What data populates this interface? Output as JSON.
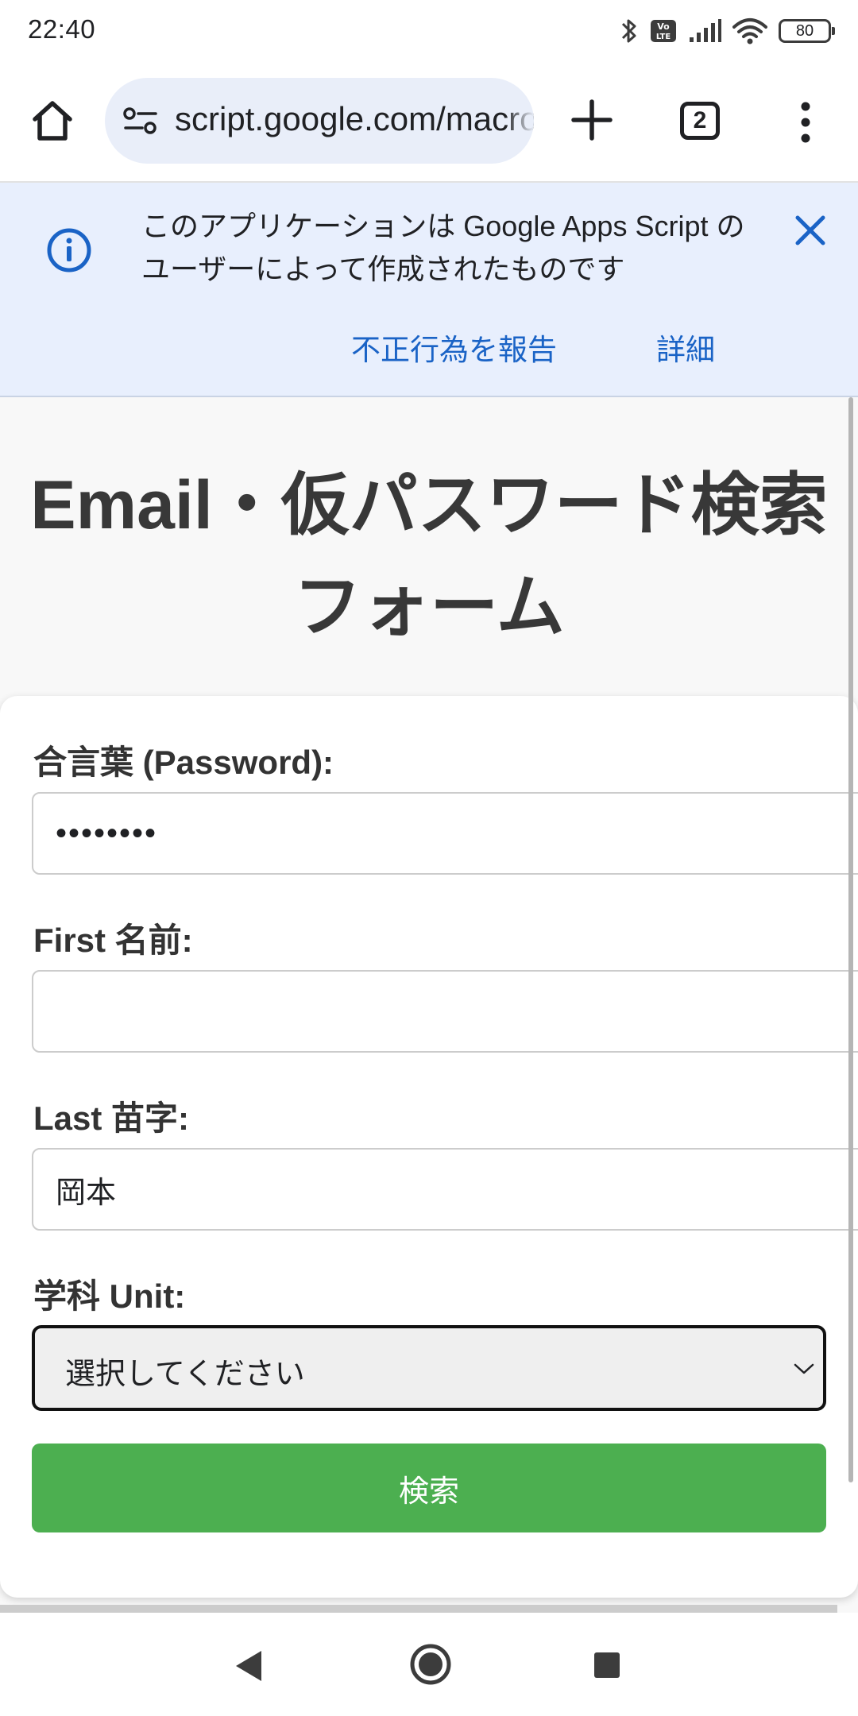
{
  "status_bar": {
    "time": "22:40",
    "battery_level": "80",
    "network_badge": "Vo LTE"
  },
  "browser": {
    "url": "script.google.com/macros/s",
    "tab_count": "2",
    "icons": [
      "home-icon",
      "site-settings-icon",
      "new-tab-icon",
      "tabs-icon",
      "menu-icon"
    ]
  },
  "banner": {
    "message": "このアプリケーションは Google Apps Script のユーザーによって作成されたものです",
    "report_link": "不正行為を報告",
    "details_link": "詳細",
    "icons": [
      "info-icon",
      "close-icon"
    ],
    "background_color": "#e8effd",
    "link_color": "#1a63c6"
  },
  "page": {
    "title_line1": "Email・仮パスワード検索",
    "title_line2": "フォーム",
    "form": {
      "password_label": "合言葉 (Password):",
      "password_value": "••••••••",
      "first_name_label": "First 名前:",
      "first_name_value": "",
      "last_name_label": "Last 苗字:",
      "last_name_value": "岡本",
      "unit_label": "学科 Unit:",
      "unit_selected": "選択してください",
      "submit_label": "検索",
      "submit_color": "#4caf50"
    }
  },
  "nav_bar": {
    "icons": [
      "back-icon",
      "home-circle-icon",
      "recents-icon"
    ]
  }
}
